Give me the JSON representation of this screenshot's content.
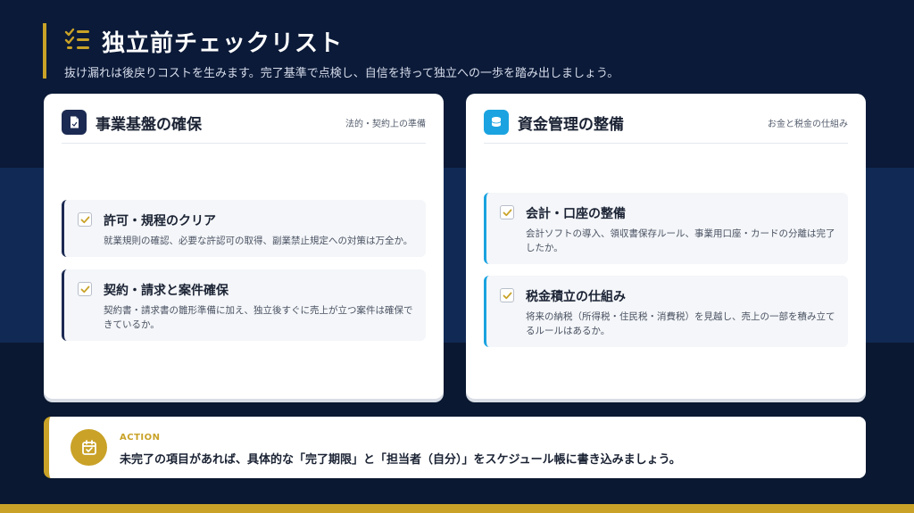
{
  "header": {
    "title": "独立前チェックリスト",
    "subtitle": "抜け漏れは後戻りコストを生みます。完了基準で点検し、自信を持って独立への一歩を踏み出しましょう。",
    "title_icon": "checklist-icon"
  },
  "cards": [
    {
      "title": "事業基盤の確保",
      "tag": "法的・契約上の準備",
      "icon": "document-icon",
      "items": [
        {
          "title": "許可・規程のクリア",
          "desc": "就業規則の確認、必要な許認可の取得、副業禁止規定への対策は万全か。"
        },
        {
          "title": "契約・請求と案件確保",
          "desc": "契約書・請求書の雛形準備に加え、独立後すぐに売上が立つ案件は確保できているか。"
        }
      ]
    },
    {
      "title": "資金管理の整備",
      "tag": "お金と税金の仕組み",
      "icon": "coins-icon",
      "items": [
        {
          "title": "会計・口座の整備",
          "desc": "会計ソフトの導入、領収書保存ルール、事業用口座・カードの分離は完了したか。"
        },
        {
          "title": "税金積立の仕組み",
          "desc": "将来の納税（所得税・住民税・消費税）を見越し、売上の一部を積み立てるルールはあるか。"
        }
      ]
    }
  ],
  "action": {
    "label": "ACTION",
    "text": "未完了の項目があれば、具体的な「完了期限」と「担当者（自分）」をスケジュール帳に書き込みましょう。",
    "icon": "calendar-check-icon"
  },
  "colors": {
    "navy": "#0b1a38",
    "gold": "#c9a227",
    "blue": "#1aa3e0",
    "dark_navy": "#1b2a52"
  }
}
